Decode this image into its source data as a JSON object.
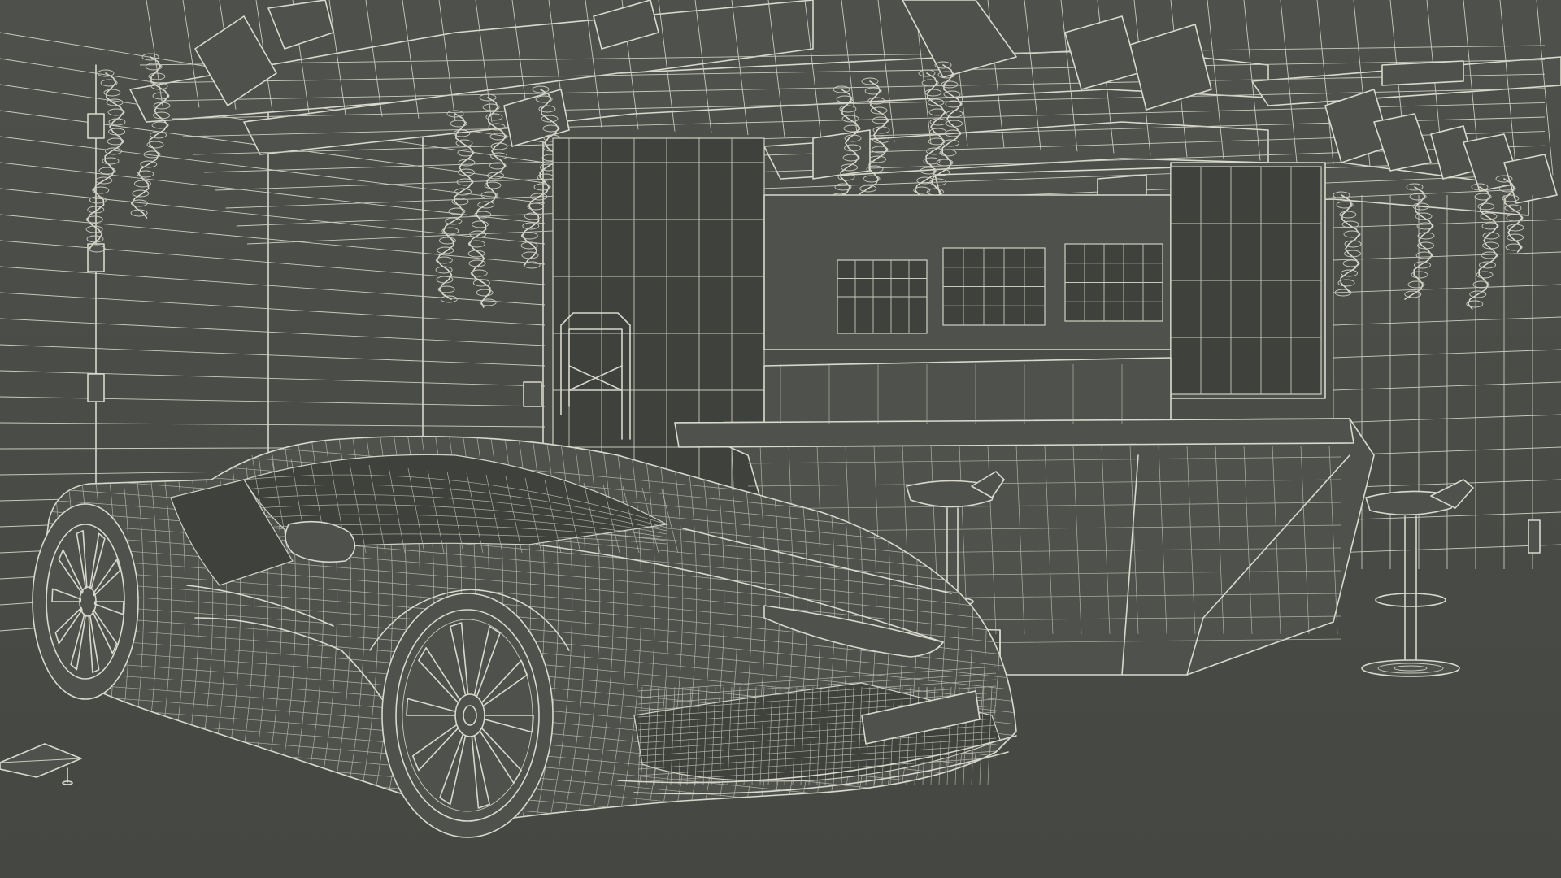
{
  "scene": {
    "subject": "wireframe-render",
    "colors": {
      "background": "#4a4c48",
      "wire": "#d8d9cc",
      "wire_fine": "#bfc0b3",
      "surface": "#4f514d"
    }
  }
}
